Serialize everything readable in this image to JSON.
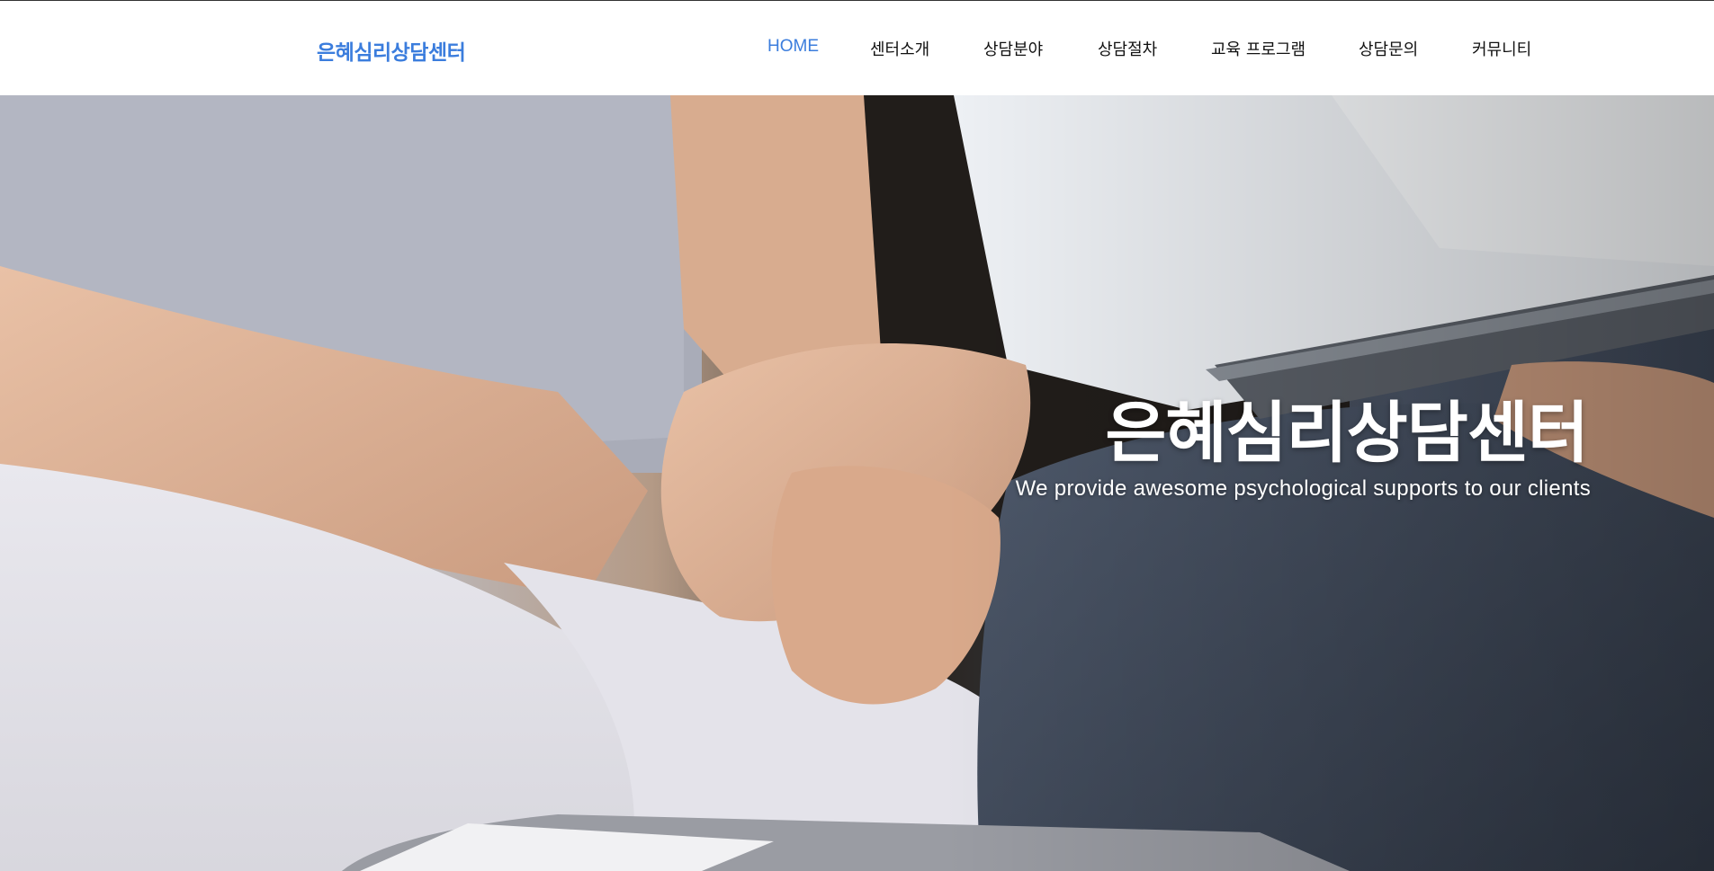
{
  "header": {
    "logo_text": "은혜심리상담센터",
    "nav": [
      {
        "label": "HOME",
        "active": true
      },
      {
        "label": "센터소개",
        "active": false
      },
      {
        "label": "상담분야",
        "active": false
      },
      {
        "label": "상담절차",
        "active": false
      },
      {
        "label": "교육 프로그램",
        "active": false
      },
      {
        "label": "상담문의",
        "active": false
      },
      {
        "label": "커뮤니티",
        "active": false
      }
    ]
  },
  "hero": {
    "title": "은혜심리상담센터",
    "subtitle": "We provide awesome psychological supports to our clients"
  },
  "colors": {
    "accent": "#3b7ddd",
    "nav_text": "#111111",
    "hero_text": "#ffffff"
  }
}
